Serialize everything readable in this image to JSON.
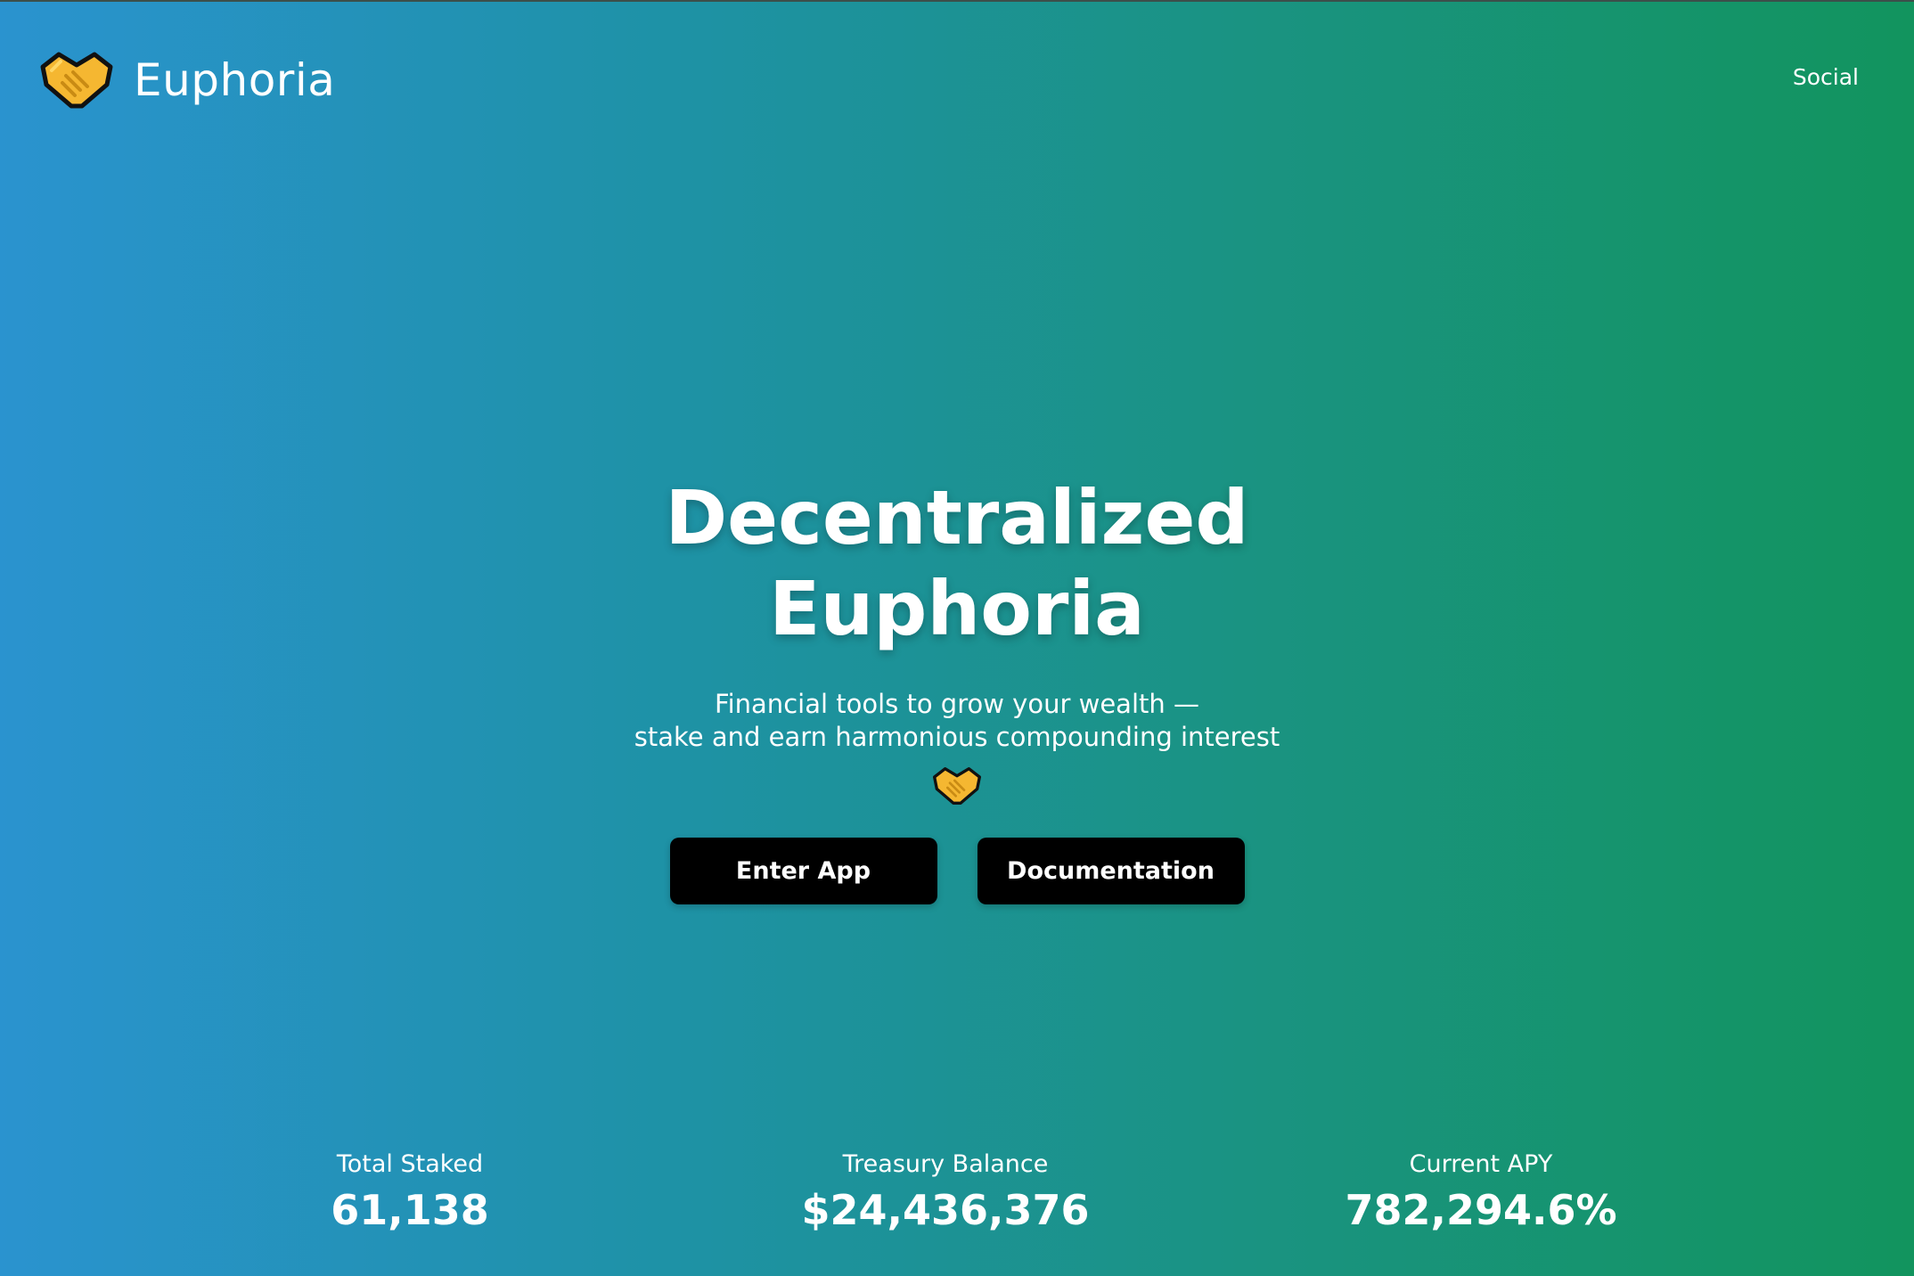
{
  "brand": {
    "name": "Euphoria",
    "logo_icon": "handshake-icon"
  },
  "nav": {
    "social_label": "Social"
  },
  "hero": {
    "title_line1": "Decentralized",
    "title_line2": "Euphoria",
    "subtitle_line1": "Financial tools to grow your wealth —",
    "subtitle_line2": "stake and earn harmonious compounding interest",
    "emoji_icon": "handshake-icon"
  },
  "actions": {
    "enter_app_label": "Enter App",
    "documentation_label": "Documentation"
  },
  "stats": [
    {
      "label": "Total Staked",
      "value": "61,138"
    },
    {
      "label": "Treasury Balance",
      "value": "$24,436,376"
    },
    {
      "label": "Current APY",
      "value": "782,294.6%"
    }
  ],
  "colors": {
    "gradient_start": "#2a93cf",
    "gradient_end": "#12945e",
    "button_bg": "#000000",
    "text": "#ffffff",
    "logo_gold": "#f5b731"
  }
}
